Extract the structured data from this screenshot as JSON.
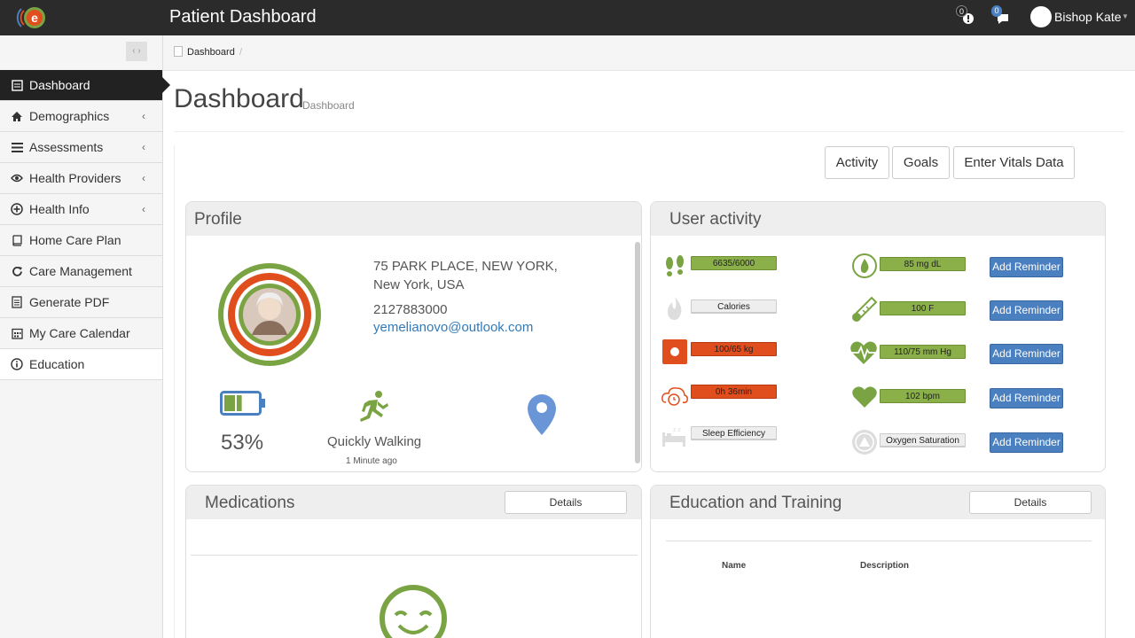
{
  "app": {
    "title": "Patient Dashboard"
  },
  "header": {
    "alerts_count": "0",
    "messages_count": "0",
    "user_name": "Bishop Kate",
    "colors": {
      "bar": "#2b2b2b",
      "alerts_badge": "#222222",
      "messages_badge": "#4a7fc0"
    }
  },
  "sidebar": {
    "items": [
      {
        "label": "Dashboard",
        "icon": "dashboard-icon",
        "active": true
      },
      {
        "label": "Demographics",
        "icon": "home-icon",
        "chevron": true
      },
      {
        "label": "Assessments",
        "icon": "list-icon",
        "chevron": true
      },
      {
        "label": "Health Providers",
        "icon": "eye-icon",
        "chevron": true
      },
      {
        "label": "Health Info",
        "icon": "plus-circle-icon",
        "chevron": true
      },
      {
        "label": "Home Care Plan",
        "icon": "book-icon"
      },
      {
        "label": "Care Management",
        "icon": "refresh-icon"
      },
      {
        "label": "Generate PDF",
        "icon": "document-icon"
      },
      {
        "label": "My Care Calendar",
        "icon": "calendar-icon"
      },
      {
        "label": "Education",
        "icon": "info-icon"
      }
    ]
  },
  "breadcrumb": {
    "current": "Dashboard",
    "separator": "/"
  },
  "page": {
    "title": "Dashboard",
    "subtitle": "Dashboard"
  },
  "actions": {
    "activity": "Activity",
    "goals": "Goals",
    "enter_vitals": "Enter Vitals Data"
  },
  "profile": {
    "title": "Profile",
    "address_line1": "75 PARK PLACE, NEW YORK,",
    "address_line2": "New York, USA",
    "phone": "2127883000",
    "email": "yemelianovo@outlook.com",
    "battery_percent": "53%",
    "battery_level": 0.53,
    "activity_label": "Quickly Walking",
    "activity_time": "1 Minute ago",
    "colors": {
      "ring_outer": "#7aa443",
      "ring_inner": "#e14e1d",
      "battery": "#4a7fc0",
      "pin": "#6a96d8"
    }
  },
  "user_activity": {
    "title": "User activity",
    "left": [
      {
        "icon": "footprints-icon",
        "value": "6635/6000",
        "status": "green"
      },
      {
        "icon": "flame-icon",
        "value": "Calories",
        "status": "gray"
      },
      {
        "icon": "scale-icon",
        "value": "100/65 kg",
        "status": "red"
      },
      {
        "icon": "sleep-clock-icon",
        "value": "0h 36min",
        "status": "red"
      },
      {
        "icon": "bed-icon",
        "value": "Sleep Efficiency",
        "status": "gray"
      }
    ],
    "right": [
      {
        "icon": "glucose-drop-icon",
        "value": "85 mg dL",
        "status": "green",
        "button": "Add Reminder"
      },
      {
        "icon": "thermometer-icon",
        "value": "100 F",
        "status": "green",
        "button": "Add Reminder"
      },
      {
        "icon": "heart-pulse-icon",
        "value": "110/75 mm Hg",
        "status": "green",
        "button": "Add Reminder"
      },
      {
        "icon": "heart-icon",
        "value": "102 bpm",
        "status": "green",
        "button": "Add Reminder"
      },
      {
        "icon": "oxygen-icon",
        "value": "Oxygen Saturation",
        "status": "gray",
        "button": "Add Reminder"
      }
    ]
  },
  "medications": {
    "title": "Medications",
    "details": "Details"
  },
  "education": {
    "title": "Education and Training",
    "details": "Details",
    "col_name": "Name",
    "col_description": "Description"
  }
}
